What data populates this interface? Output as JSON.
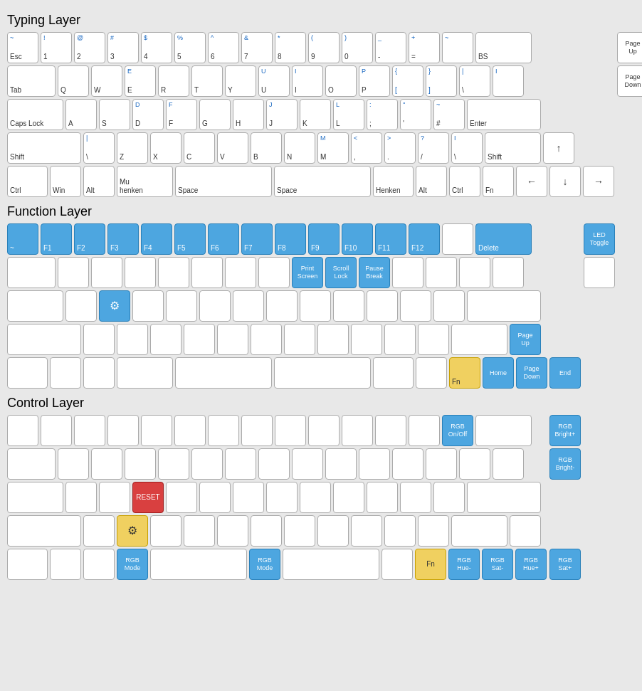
{
  "sections": [
    {
      "title": "Typing Layer"
    },
    {
      "title": "Function Layer"
    },
    {
      "title": "Control Layer"
    }
  ]
}
